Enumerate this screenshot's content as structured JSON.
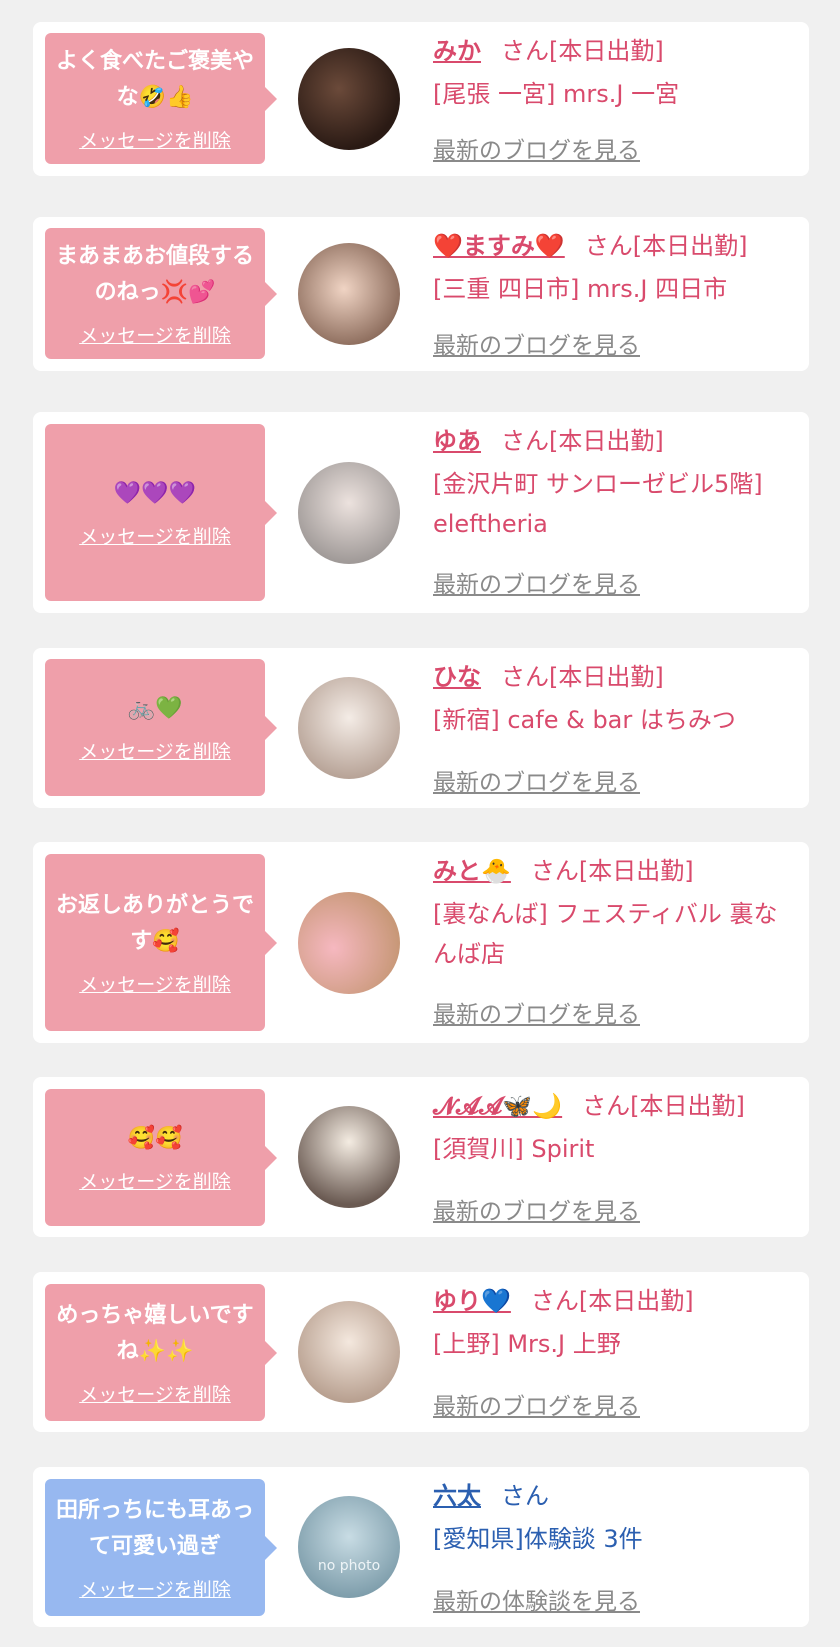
{
  "cards": [
    {
      "message": "よく食べたご褒美やな🤣👍",
      "delete_label": "メッセージを削除",
      "name": "みか",
      "suffix": "さん[本日出勤]",
      "shop": "[尾張 一宮] mrs.J 一宮",
      "blog_label": "最新のブログを見る",
      "avatar_colors": [
        "#2a1a14",
        "#6b4a3a"
      ]
    },
    {
      "message": "まあまあお値段するのねっ💢💕",
      "delete_label": "メッセージを削除",
      "name": "❤️ますみ❤️",
      "suffix": "さん[本日出勤]",
      "shop": "[三重 四日市] mrs.J 四日市",
      "blog_label": "最新のブログを見る",
      "avatar_colors": [
        "#8a6a5a",
        "#e8c8b8"
      ]
    },
    {
      "message": "💜💜💜",
      "delete_label": "メッセージを削除",
      "name": "ゆあ",
      "suffix": "さん[本日出勤]",
      "shop": "[金沢片町 サンローゼビル5階] eleftheria",
      "blog_label": "最新のブログを見る",
      "avatar_colors": [
        "#a09a98",
        "#e6dcd8"
      ]
    },
    {
      "message": "🚲💚",
      "delete_label": "メッセージを削除",
      "name": "ひな",
      "suffix": "さん[本日出勤]",
      "shop": "[新宿] cafe & bar はちみつ",
      "blog_label": "最新のブログを見る",
      "avatar_colors": [
        "#d8c8bc",
        "#f4ece6"
      ]
    },
    {
      "message": "お返しありがとうです🥰",
      "delete_label": "メッセージを削除",
      "name": "みと🐣",
      "suffix": "さん[本日出勤]",
      "shop": "[裏なんば] フェスティバル 裏なんば店",
      "blog_label": "最新のブログを見る",
      "avatar_colors": [
        "#c89878",
        "#f4d0c0"
      ]
    },
    {
      "message": "🥰🥰",
      "delete_label": "メッセージを削除",
      "name": "𝓝𝓐𝓐🦋🌙",
      "suffix": "さん[本日出勤]",
      "shop": "[須賀川] Spirit",
      "blog_label": "最新のブログを見る",
      "avatar_colors": [
        "#6a5a52",
        "#d8c4b4"
      ]
    },
    {
      "message": "めっちゃ嬉しいですね✨✨",
      "delete_label": "メッセージを削除",
      "name": "ゆり💙",
      "suffix": "さん[本日出勤]",
      "shop": "[上野] Mrs.J 上野",
      "blog_label": "最新のブログを見る",
      "avatar_colors": [
        "#b8a090",
        "#f0e4da"
      ]
    },
    {
      "message": "田所っちにも耳あって可愛い過ぎ",
      "delete_label": "メッセージを削除",
      "name": "六太",
      "suffix": "さん",
      "shop": "[愛知県]体験談 3件",
      "blog_label": "最新の体験談を見る",
      "avatar_text": "no photo",
      "avatar_colors": [
        "#7a9aa8",
        "#c8dce4"
      ]
    }
  ]
}
